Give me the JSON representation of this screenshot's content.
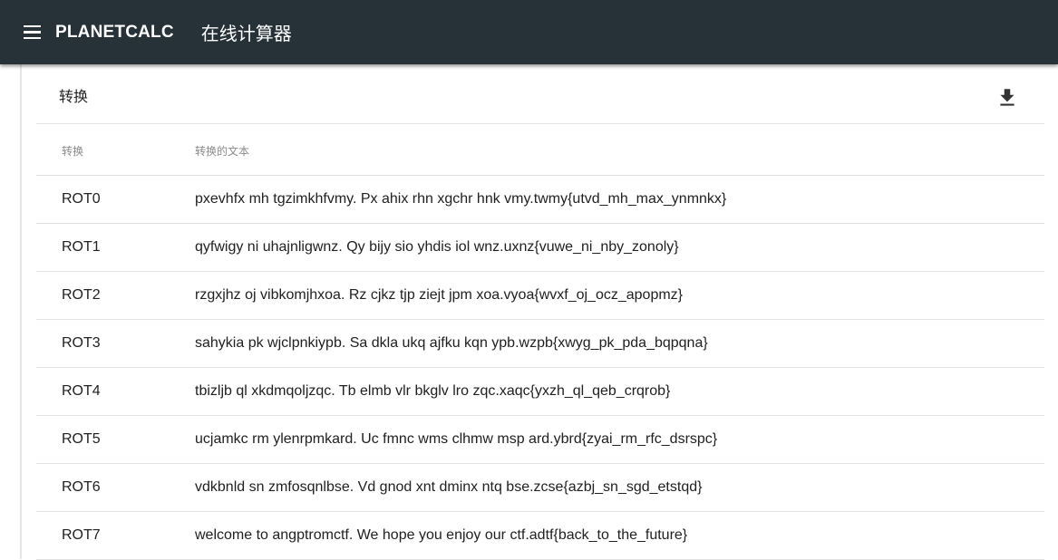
{
  "header": {
    "brand": "PLANETCALC",
    "subtitle": "在线计算器",
    "background_color": "#263238"
  },
  "card": {
    "title": "转换",
    "download_icon": "download-icon"
  },
  "table": {
    "columns": [
      "转换",
      "转换的文本"
    ],
    "rows": [
      {
        "rot": "ROT0",
        "text": "pxevhfx mh tgzimkhfvmy. Px ahix rhn xgchr hnk vmy.twmy{utvd_mh_max_ynmnkx}"
      },
      {
        "rot": "ROT1",
        "text": "qyfwigy ni uhajnligwnz. Qy bijy sio yhdis iol wnz.uxnz{vuwe_ni_nby_zonoly}"
      },
      {
        "rot": "ROT2",
        "text": "rzgxjhz oj vibkomjhxoa. Rz cjkz tjp ziejt jpm xoa.vyoa{wvxf_oj_ocz_apopmz}"
      },
      {
        "rot": "ROT3",
        "text": "sahykia pk wjclpnkiypb. Sa dkla ukq ajfku kqn ypb.wzpb{xwyg_pk_pda_bqpqna}"
      },
      {
        "rot": "ROT4",
        "text": "tbizljb ql xkdmqoljzqc. Tb elmb vlr bkglv lro zqc.xaqc{yxzh_ql_qeb_crqrob}"
      },
      {
        "rot": "ROT5",
        "text": "ucjamkc rm ylenrpmkard. Uc fmnc wms clhmw msp ard.ybrd{zyai_rm_rfc_dsrspc}"
      },
      {
        "rot": "ROT6",
        "text": "vdkbnld sn zmfosqnlbse. Vd gnod xnt dminx ntq bse.zcse{azbj_sn_sgd_etstqd}"
      },
      {
        "rot": "ROT7",
        "text": "welcome to angptromctf. We hope you enjoy our ctf.adtf{back_to_the_future}"
      }
    ]
  }
}
